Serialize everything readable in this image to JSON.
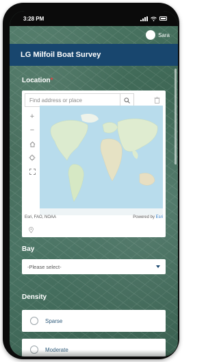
{
  "status": {
    "time": "3:28 PM"
  },
  "user": {
    "name": "Sara"
  },
  "header": {
    "title": "LG Milfoil Boat Survey"
  },
  "location": {
    "label": "Location",
    "required_mark": "*",
    "search_placeholder": "Find address or place",
    "attribution_left": "Esri, FAO, NOAA",
    "attribution_right_prefix": "Powered by ",
    "attribution_right_link": "Esri"
  },
  "bay": {
    "label": "Bay",
    "selected": "-Please select-"
  },
  "density": {
    "label": "Density",
    "options": [
      "Sparse",
      "Moderate"
    ]
  },
  "colors": {
    "header_bg": "#18466e",
    "accent": "#1a6fc0",
    "required": "#e04040"
  },
  "icons": [
    "search-icon",
    "trash-icon",
    "zoom-in-icon",
    "zoom-out-icon",
    "home-icon",
    "locate-icon",
    "fullscreen-icon",
    "map-pin-icon",
    "chevron-down-icon"
  ]
}
